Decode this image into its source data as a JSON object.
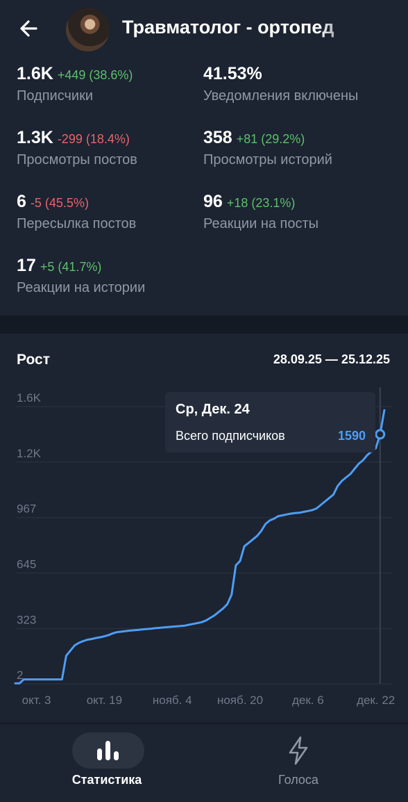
{
  "header": {
    "title": "Травматолог - ортопед"
  },
  "stats": [
    {
      "value": "1.6K",
      "delta": "+449 (38.6%)",
      "delta_sign": "pos",
      "label": "Подписчики"
    },
    {
      "value": "41.53%",
      "delta": "",
      "delta_sign": "pos",
      "label": "Уведомления включены"
    },
    {
      "value": "1.3K",
      "delta": "-299 (18.4%)",
      "delta_sign": "neg",
      "label": "Просмотры постов"
    },
    {
      "value": "358",
      "delta": "+81 (29.2%)",
      "delta_sign": "pos",
      "label": "Просмотры историй"
    },
    {
      "value": "6",
      "delta": "-5 (45.5%)",
      "delta_sign": "neg",
      "label": "Пересылка постов"
    },
    {
      "value": "96",
      "delta": "+18 (23.1%)",
      "delta_sign": "pos",
      "label": "Реакции на посты"
    },
    {
      "value": "17",
      "delta": "+5 (41.7%)",
      "delta_sign": "pos",
      "label": "Реакции на истории"
    }
  ],
  "chart_section": {
    "title": "Рост",
    "range": "28.09.25 — 25.12.25"
  },
  "tooltip": {
    "date": "Ср, Дек. 24",
    "label": "Всего подписчиков",
    "value": "1590"
  },
  "nav": {
    "stats_label": "Статистика",
    "voices_label": "Голоса",
    "stats_icon": "bar-chart-icon",
    "voices_icon": "lightning-icon"
  },
  "colors": {
    "line": "#4d9ef5",
    "positive": "#5cc16a",
    "negative": "#e9646b",
    "background": "#1c2331"
  },
  "chart_data": {
    "type": "line",
    "y_ticks": [
      "2",
      "323",
      "645",
      "967",
      "1.2K",
      "1.6K"
    ],
    "y_tick_values": [
      2,
      323,
      645,
      967,
      1289,
      1611
    ],
    "x_ticks": [
      "окт. 3",
      "окт. 19",
      "нояб. 4",
      "нояб. 20",
      "дек. 6",
      "дек. 22"
    ],
    "x_tick_days": [
      5,
      21,
      37,
      53,
      69,
      85
    ],
    "ylim": [
      2,
      1611
    ],
    "xlim": [
      0,
      88
    ],
    "series": [
      {
        "name": "Всего подписчиков",
        "x": [
          0,
          1,
          2,
          3,
          4,
          5,
          6,
          7,
          8,
          9,
          10,
          11,
          12,
          13,
          14,
          15,
          16,
          17,
          18,
          19,
          20,
          21,
          22,
          23,
          24,
          25,
          26,
          27,
          28,
          29,
          30,
          31,
          32,
          33,
          34,
          35,
          36,
          37,
          38,
          39,
          40,
          41,
          42,
          43,
          44,
          45,
          46,
          47,
          48,
          49,
          50,
          51,
          52,
          53,
          54,
          55,
          56,
          57,
          58,
          59,
          60,
          61,
          62,
          63,
          64,
          65,
          66,
          67,
          68,
          69,
          70,
          71,
          72,
          73,
          74,
          75,
          76,
          77,
          78,
          79,
          80,
          81,
          82,
          83,
          84,
          85,
          86,
          87
        ],
        "values": [
          5,
          5,
          28,
          28,
          28,
          28,
          28,
          28,
          28,
          28,
          28,
          28,
          165,
          195,
          225,
          240,
          250,
          258,
          262,
          268,
          272,
          278,
          285,
          295,
          302,
          305,
          308,
          311,
          313,
          315,
          318,
          320,
          322,
          325,
          327,
          330,
          332,
          334,
          336,
          338,
          340,
          345,
          350,
          355,
          360,
          370,
          385,
          400,
          420,
          440,
          465,
          520,
          690,
          715,
          800,
          820,
          840,
          860,
          890,
          930,
          950,
          960,
          975,
          980,
          985,
          990,
          993,
          995,
          1000,
          1005,
          1010,
          1020,
          1040,
          1060,
          1080,
          1100,
          1150,
          1180,
          1200,
          1220,
          1250,
          1280,
          1300,
          1330,
          1350,
          1370,
          1450,
          1590
        ]
      }
    ],
    "tooltip_day": 86,
    "grid": true
  }
}
